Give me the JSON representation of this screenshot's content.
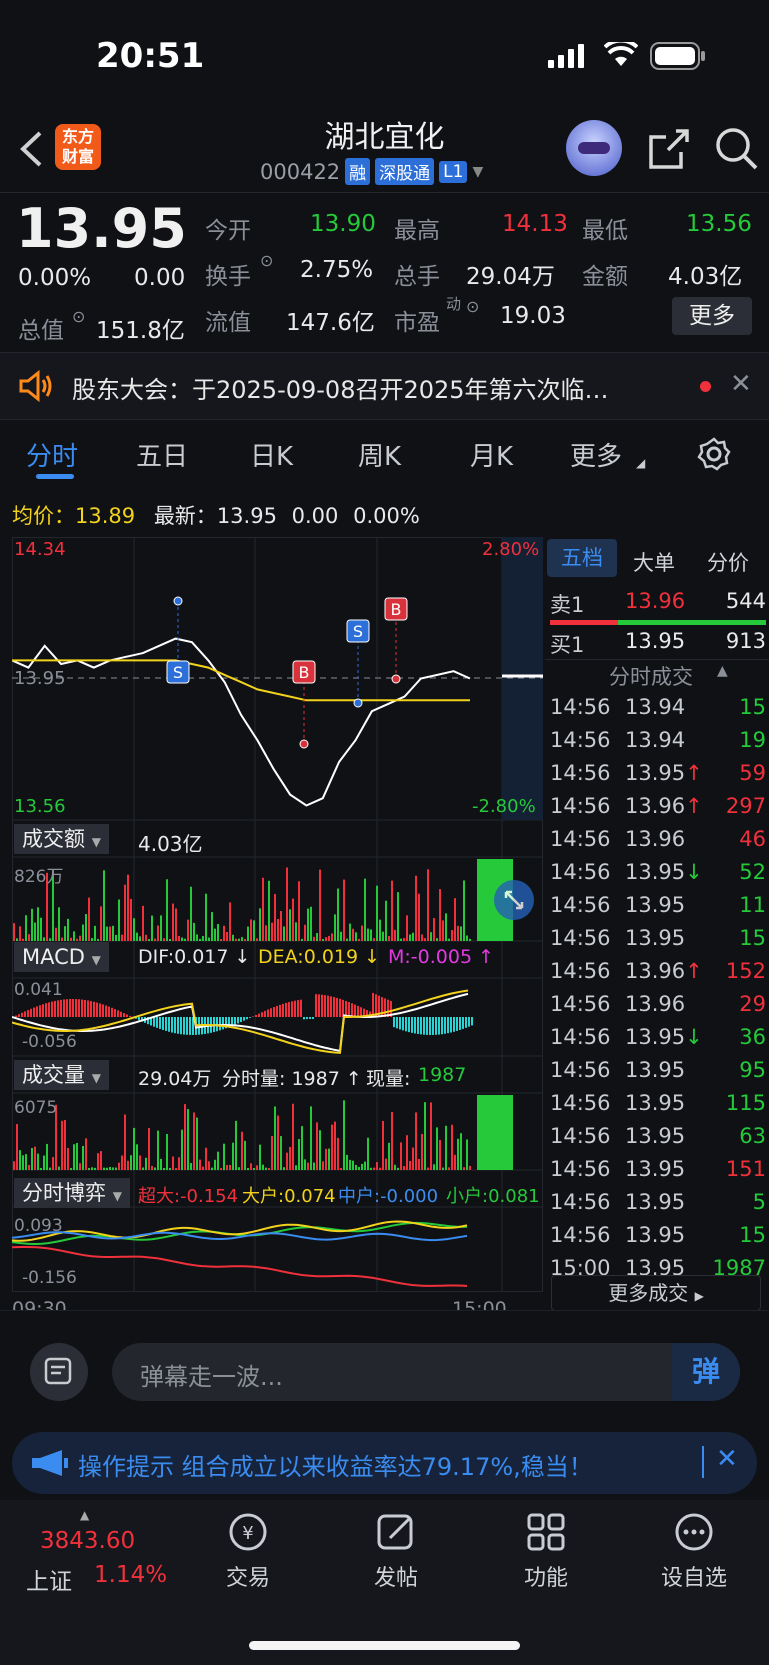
{
  "status": {
    "time": "20:51"
  },
  "header": {
    "logo_line1": "东方",
    "logo_line2": "财富",
    "title": "湖北宜化",
    "code": "000422",
    "tags": [
      "融",
      "深股通",
      "L1"
    ]
  },
  "quote": {
    "price": "13.95",
    "change_pct": "0.00%",
    "change": "0.00",
    "open_label": "今开",
    "open": "13.90",
    "high_label": "最高",
    "high": "14.13",
    "low_label": "最低",
    "low": "13.56",
    "turnover_label": "换手",
    "turnover": "2.75%",
    "volume_label": "总手",
    "volume": "29.04万",
    "amount_label": "金额",
    "amount": "4.03亿",
    "mktcap_label": "总值",
    "mktcap": "151.8亿",
    "float_label": "流值",
    "float": "147.6亿",
    "pe_label": "市盈",
    "pe_sup": "动",
    "pe": "19.03",
    "more_button": "更多"
  },
  "notice": {
    "text": "股东大会：于2025-09-08召开2025年第六次临…"
  },
  "tabs": [
    "分时",
    "五日",
    "日K",
    "周K",
    "月K",
    "更多"
  ],
  "statline": {
    "avg_label": "均价：",
    "avg": "13.89",
    "latest_label": "最新：",
    "latest": "13.95",
    "latest_chg": "0.00",
    "latest_pct": "0.00%"
  },
  "chart_labels": {
    "top_price": "14.34",
    "top_pct": "2.80%",
    "mid_price": "13.95",
    "bottom_price": "13.56",
    "bottom_pct": "-2.80%",
    "amount_btn": "成交额",
    "amount_val": "4.03亿",
    "amount_max": "826万",
    "macd_btn": "MACD",
    "dif": "DIF:0.017 ↓",
    "dea": "DEA:0.019 ↓",
    "m": "M:-0.005 ↑",
    "macd_top": "0.041",
    "macd_bottom": "-0.056",
    "vol_btn": "成交量",
    "vol_val": "29.04万",
    "vol_interval": "分时量: 1987 ↑",
    "vol_now_label": "现量:",
    "vol_now": "1987",
    "vol_max": "6075",
    "game_btn": "分时博弈",
    "super": "超大:-0.154",
    "big": "大户:0.074",
    "mid": "中户:-0.000",
    "small": "小户:0.081",
    "game_top": "0.093",
    "game_bottom": "-0.156",
    "time_start": "09:30",
    "time_end": "15:00",
    "marker_s": "S",
    "marker_b": "B"
  },
  "chart_data": {
    "type": "line",
    "title": "",
    "xlabel": "",
    "ylabel": "",
    "x": [
      "09:30",
      "15:00"
    ],
    "ylim": [
      13.56,
      14.34
    ],
    "series": [
      {
        "name": "价格",
        "color": "#ffffff",
        "values": [
          14.0,
          13.98,
          14.04,
          13.99,
          14.0,
          13.98,
          14.0,
          14.01,
          14.02,
          14.04,
          14.06,
          14.05,
          14.0,
          13.94,
          13.85,
          13.78,
          13.7,
          13.63,
          13.6,
          13.62,
          13.72,
          13.78,
          13.86,
          13.88,
          13.9,
          13.95,
          13.96,
          13.97,
          13.95
        ]
      },
      {
        "name": "均价",
        "color": "#f2d21c",
        "values": [
          14.0,
          14.0,
          14.0,
          14.0,
          14.0,
          14.0,
          14.0,
          14.0,
          14.0,
          14.0,
          14.0,
          13.99,
          13.98,
          13.96,
          13.94,
          13.92,
          13.91,
          13.9,
          13.89,
          13.89,
          13.89,
          13.89,
          13.89,
          13.89,
          13.89,
          13.89,
          13.89,
          13.89,
          13.89
        ]
      }
    ]
  },
  "orderbook": {
    "tabs": [
      "五档",
      "大单",
      "分价"
    ],
    "sell_label": "卖1",
    "sell_price": "13.96",
    "sell_vol": "544",
    "buy_label": "买1",
    "buy_price": "13.95",
    "buy_vol": "913",
    "trades_title": "分时成交",
    "trades": [
      {
        "t": "14:56",
        "p": "13.94",
        "pc": "green",
        "v": "15",
        "vc": "green",
        "arrow": ""
      },
      {
        "t": "14:56",
        "p": "13.94",
        "pc": "green",
        "v": "19",
        "vc": "green",
        "arrow": ""
      },
      {
        "t": "14:56",
        "p": "13.95",
        "pc": "white",
        "v": "59",
        "vc": "red",
        "arrow": "↑"
      },
      {
        "t": "14:56",
        "p": "13.96",
        "pc": "red",
        "v": "297",
        "vc": "red",
        "arrow": "↑"
      },
      {
        "t": "14:56",
        "p": "13.96",
        "pc": "red",
        "v": "46",
        "vc": "red",
        "arrow": ""
      },
      {
        "t": "14:56",
        "p": "13.95",
        "pc": "white",
        "v": "52",
        "vc": "green",
        "arrow": "↓"
      },
      {
        "t": "14:56",
        "p": "13.95",
        "pc": "white",
        "v": "11",
        "vc": "green",
        "arrow": ""
      },
      {
        "t": "14:56",
        "p": "13.95",
        "pc": "white",
        "v": "15",
        "vc": "green",
        "arrow": ""
      },
      {
        "t": "14:56",
        "p": "13.96",
        "pc": "red",
        "v": "152",
        "vc": "red",
        "arrow": "↑"
      },
      {
        "t": "14:56",
        "p": "13.96",
        "pc": "red",
        "v": "29",
        "vc": "red",
        "arrow": ""
      },
      {
        "t": "14:56",
        "p": "13.95",
        "pc": "white",
        "v": "36",
        "vc": "green",
        "arrow": "↓"
      },
      {
        "t": "14:56",
        "p": "13.95",
        "pc": "white",
        "v": "95",
        "vc": "green",
        "arrow": ""
      },
      {
        "t": "14:56",
        "p": "13.95",
        "pc": "white",
        "v": "115",
        "vc": "green",
        "arrow": ""
      },
      {
        "t": "14:56",
        "p": "13.95",
        "pc": "white",
        "v": "63",
        "vc": "green",
        "arrow": ""
      },
      {
        "t": "14:56",
        "p": "13.95",
        "pc": "white",
        "v": "151",
        "vc": "red",
        "arrow": ""
      },
      {
        "t": "14:56",
        "p": "13.95",
        "pc": "white",
        "v": "5",
        "vc": "green",
        "arrow": ""
      },
      {
        "t": "14:56",
        "p": "13.95",
        "pc": "white",
        "v": "15",
        "vc": "green",
        "arrow": ""
      },
      {
        "t": "15:00",
        "p": "13.95",
        "pc": "white",
        "v": "1987",
        "vc": "green",
        "arrow": ""
      }
    ],
    "more_trades": "更多成交"
  },
  "input": {
    "placeholder": "弹幕走一波...",
    "send": "弹"
  },
  "tip": {
    "text": "操作提示 组合成立以来收益率达79.17%,稳当！"
  },
  "bottomnav": {
    "index_value": "3843.60",
    "index_name": "上证",
    "index_pct": "1.14%",
    "items": [
      "交易",
      "发帖",
      "功能",
      "设自选"
    ]
  }
}
